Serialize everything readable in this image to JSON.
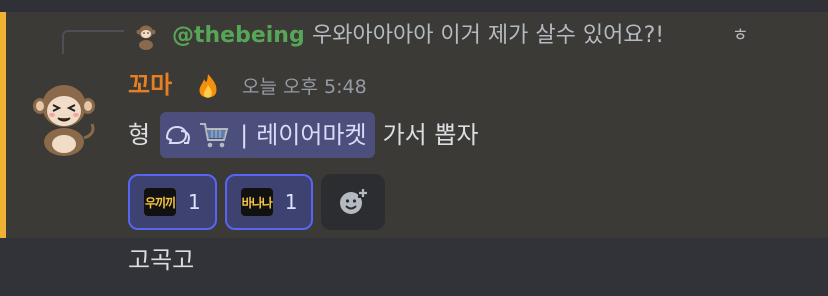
{
  "reply": {
    "mention": "@thebeing",
    "text": "우와아아아아 이거 제가 살수 있어요?!",
    "icon": "image-attachment-icon",
    "icon_glyph": "ㅎ"
  },
  "message": {
    "author": "꼬마",
    "author_badge": "fire-emoji",
    "timestamp": "오늘 오후 5:48",
    "prefix": "형",
    "channel": {
      "icon": "forum-channel-icon",
      "emoji": "shopping-cart-emoji",
      "separator": "|",
      "name": "레이어마켓"
    },
    "suffix": "가서 뽑자"
  },
  "reactions": [
    {
      "emoji_text": "우끼끼",
      "count": "1"
    },
    {
      "emoji_text": "바나나",
      "count": "1"
    }
  ],
  "add_reaction": {
    "icon": "add-reaction-icon"
  },
  "next_message": {
    "text": "고곡고"
  },
  "colors": {
    "highlight_bar": "#f0b232",
    "mention": "#57a657",
    "author": "#e67e22",
    "channel_pill": "#4c4f7c",
    "reaction_border": "#5865f2"
  }
}
